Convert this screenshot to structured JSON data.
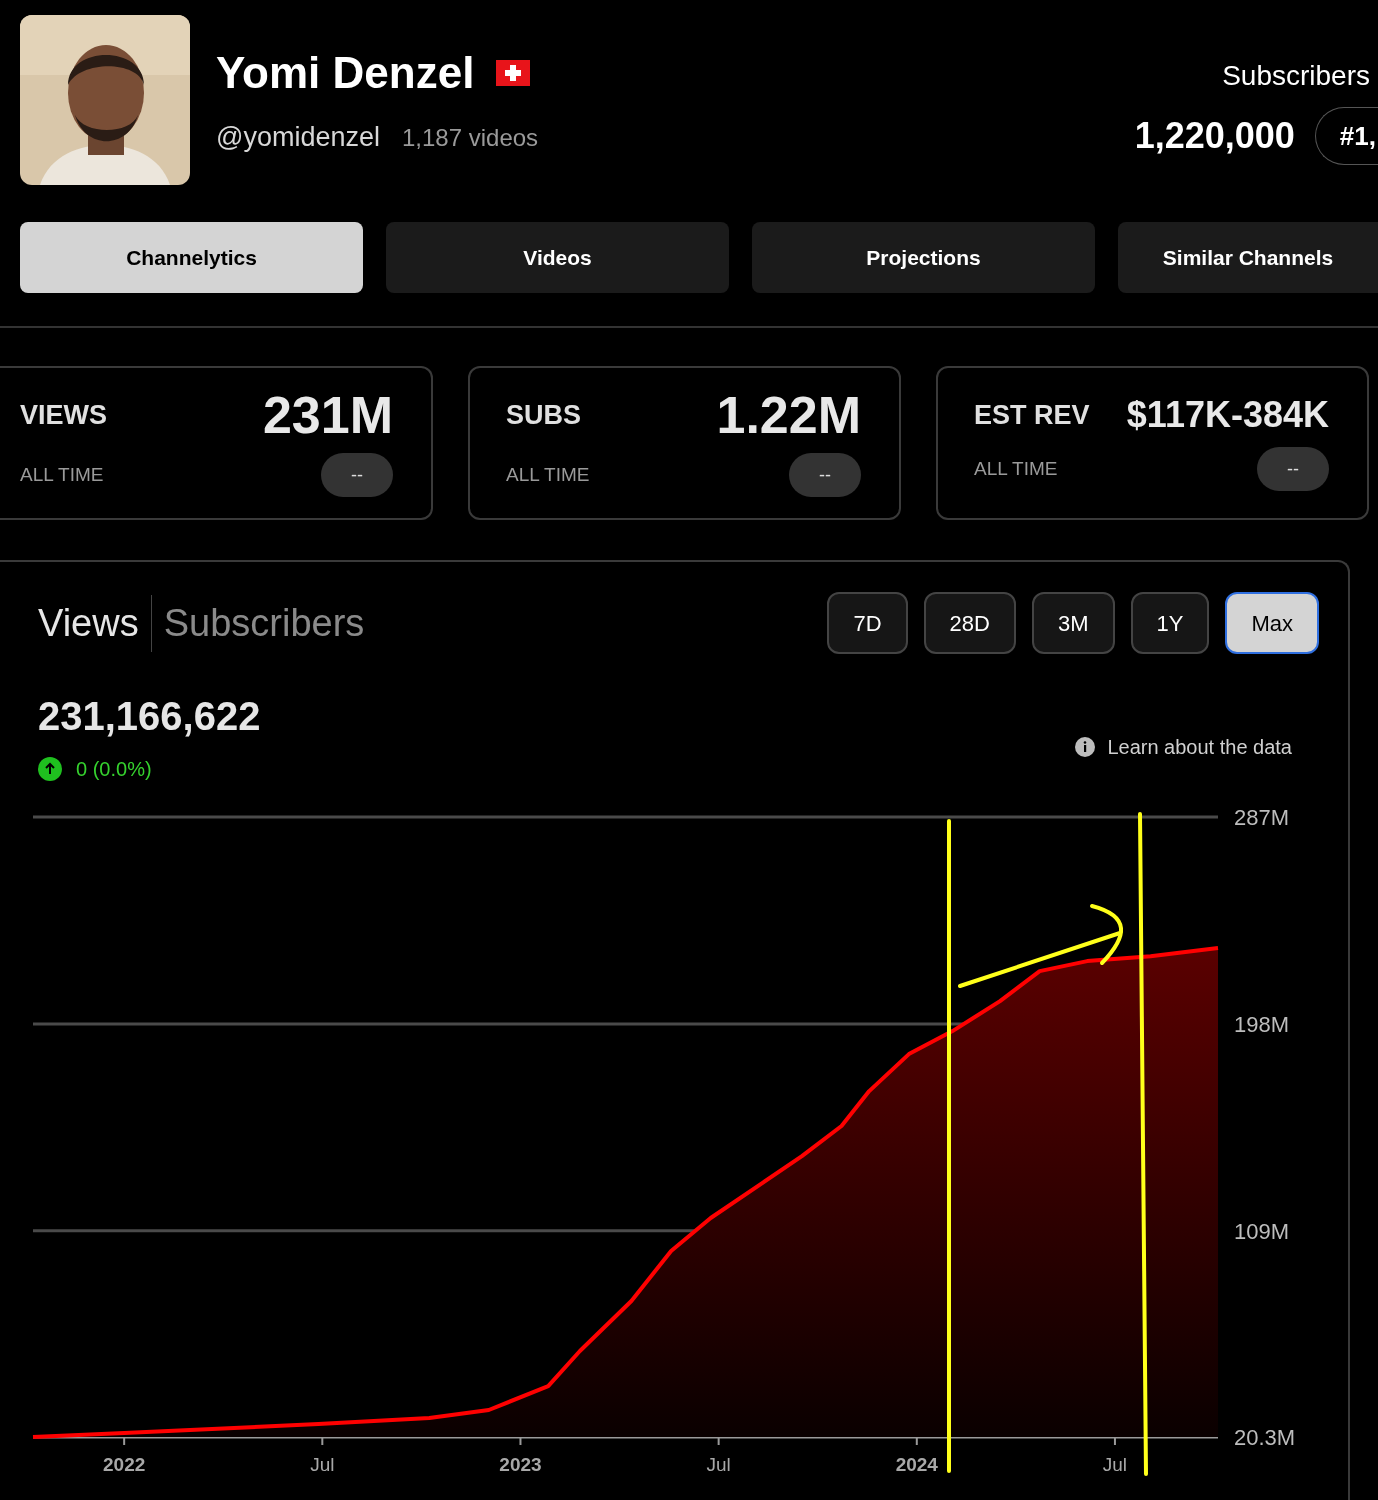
{
  "profile": {
    "name": "Yomi Denzel",
    "handle": "@yomidenzel",
    "video_count": "1,187 videos",
    "subscribers_label": "Subscribers",
    "subscribers": "1,220,000",
    "rank": "#1,"
  },
  "tabs": [
    {
      "label": "Channelytics",
      "selected": true
    },
    {
      "label": "Videos",
      "selected": false
    },
    {
      "label": "Projections",
      "selected": false
    },
    {
      "label": "Similar Channels",
      "selected": false
    }
  ],
  "stats": [
    {
      "label": "VIEWS",
      "value": "231M",
      "period": "ALL TIME",
      "change": "--"
    },
    {
      "label": "SUBS",
      "value": "1.22M",
      "period": "ALL TIME",
      "change": "--"
    },
    {
      "label": "EST REV",
      "value": "$117K-384K",
      "period": "ALL TIME",
      "change": "--"
    }
  ],
  "chart_panel": {
    "metric_tabs": [
      {
        "label": "Views",
        "selected": true
      },
      {
        "label": "Subscribers",
        "selected": false
      }
    ],
    "ranges": [
      {
        "label": "7D",
        "selected": false
      },
      {
        "label": "28D",
        "selected": false
      },
      {
        "label": "3M",
        "selected": false
      },
      {
        "label": "1Y",
        "selected": false
      },
      {
        "label": "Max",
        "selected": true
      }
    ],
    "total": "231,166,622",
    "change": "0 (0.0%)",
    "learn_link": "Learn about the data",
    "chart_data": {
      "type": "area",
      "x": [
        2021.77,
        2022.0,
        2022.49,
        2022.77,
        2022.92,
        2023.07,
        2023.15,
        2023.28,
        2023.38,
        2023.48,
        2023.61,
        2023.71,
        2023.81,
        2023.88,
        2023.98,
        2024.09,
        2024.21,
        2024.31,
        2024.43,
        2024.59,
        2024.76
      ],
      "series": [
        {
          "color": "#ff0000",
          "values": [
            20.3,
            22.0,
            25.9,
            28.5,
            31.9,
            42.2,
            57.3,
            78.8,
            100.3,
            114.5,
            129.5,
            141.1,
            154.1,
            169.1,
            185.0,
            194.9,
            207.8,
            220.7,
            225.0,
            227.1,
            230.6
          ]
        }
      ],
      "xlim": [
        2021.77,
        2024.76
      ],
      "ylim": [
        20.3,
        287
      ],
      "xticks": [
        {
          "value": 2022,
          "label": "2022"
        },
        {
          "value": 2022.5,
          "label": "Jul"
        },
        {
          "value": 2023,
          "label": "2023"
        },
        {
          "value": 2023.5,
          "label": "Jul"
        },
        {
          "value": 2024,
          "label": "2024"
        },
        {
          "value": 2024.5,
          "label": "Jul"
        }
      ],
      "yticks": [
        {
          "value": 287,
          "label": "287M"
        },
        {
          "value": 198,
          "label": "198M"
        },
        {
          "value": 109,
          "label": "109M"
        },
        {
          "value": 20.3,
          "label": "20.3M"
        }
      ]
    }
  }
}
